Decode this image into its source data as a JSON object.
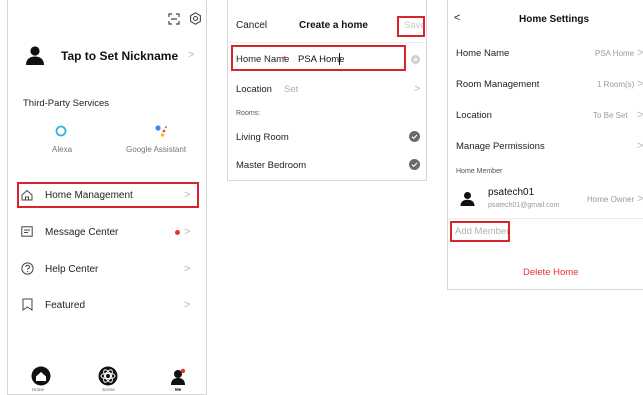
{
  "me_screen": {
    "nickname": "Tap to Set Nickname",
    "third_party_title": "Third-Party Services",
    "services": [
      {
        "label": "Alexa",
        "icon": "alexa-icon"
      },
      {
        "label": "Google Assistant",
        "icon": "google-assistant-icon"
      }
    ],
    "menu": [
      {
        "label": "Home Management",
        "icon": "house-icon"
      },
      {
        "label": "Message Center",
        "icon": "message-icon"
      },
      {
        "label": "Help Center",
        "icon": "question-icon"
      },
      {
        "label": "Featured",
        "icon": "bookmark-icon"
      }
    ],
    "tabs": [
      {
        "label": "Home",
        "icon": "home-tab-icon"
      },
      {
        "label": "Scene",
        "icon": "scene-tab-icon"
      },
      {
        "label": "Me",
        "icon": "me-tab-icon"
      }
    ],
    "badge_color": "#e8313a"
  },
  "create_home": {
    "cancel": "Cancel",
    "title": "Create a home",
    "save": "Save",
    "home_name_label": "Home Name",
    "required_mark": "•",
    "home_name_value": "PSA Home",
    "location_label": "Location",
    "location_value": "Set",
    "rooms_title": "Rooms:",
    "rooms": [
      "Living Room",
      "Master Bedroom"
    ]
  },
  "home_settings": {
    "back": "<",
    "title": "Home Settings",
    "rows": [
      {
        "label": "Home Name",
        "value": "PSA Home"
      },
      {
        "label": "Room Management",
        "value": "1 Room(s)"
      },
      {
        "label": "Location",
        "value": "To Be Set"
      },
      {
        "label": "Manage Permissions",
        "value": ""
      }
    ],
    "member_section": "Home Member",
    "member": {
      "name": "psatech01",
      "email": "psatech01@gmail.com",
      "role": "Home Owner"
    },
    "add_member": "Add Member",
    "delete_home": "Delete Home"
  },
  "colors": {
    "highlight": "#d9232d",
    "delete": "#e8313a",
    "placeholder": "#b0b0b0"
  }
}
